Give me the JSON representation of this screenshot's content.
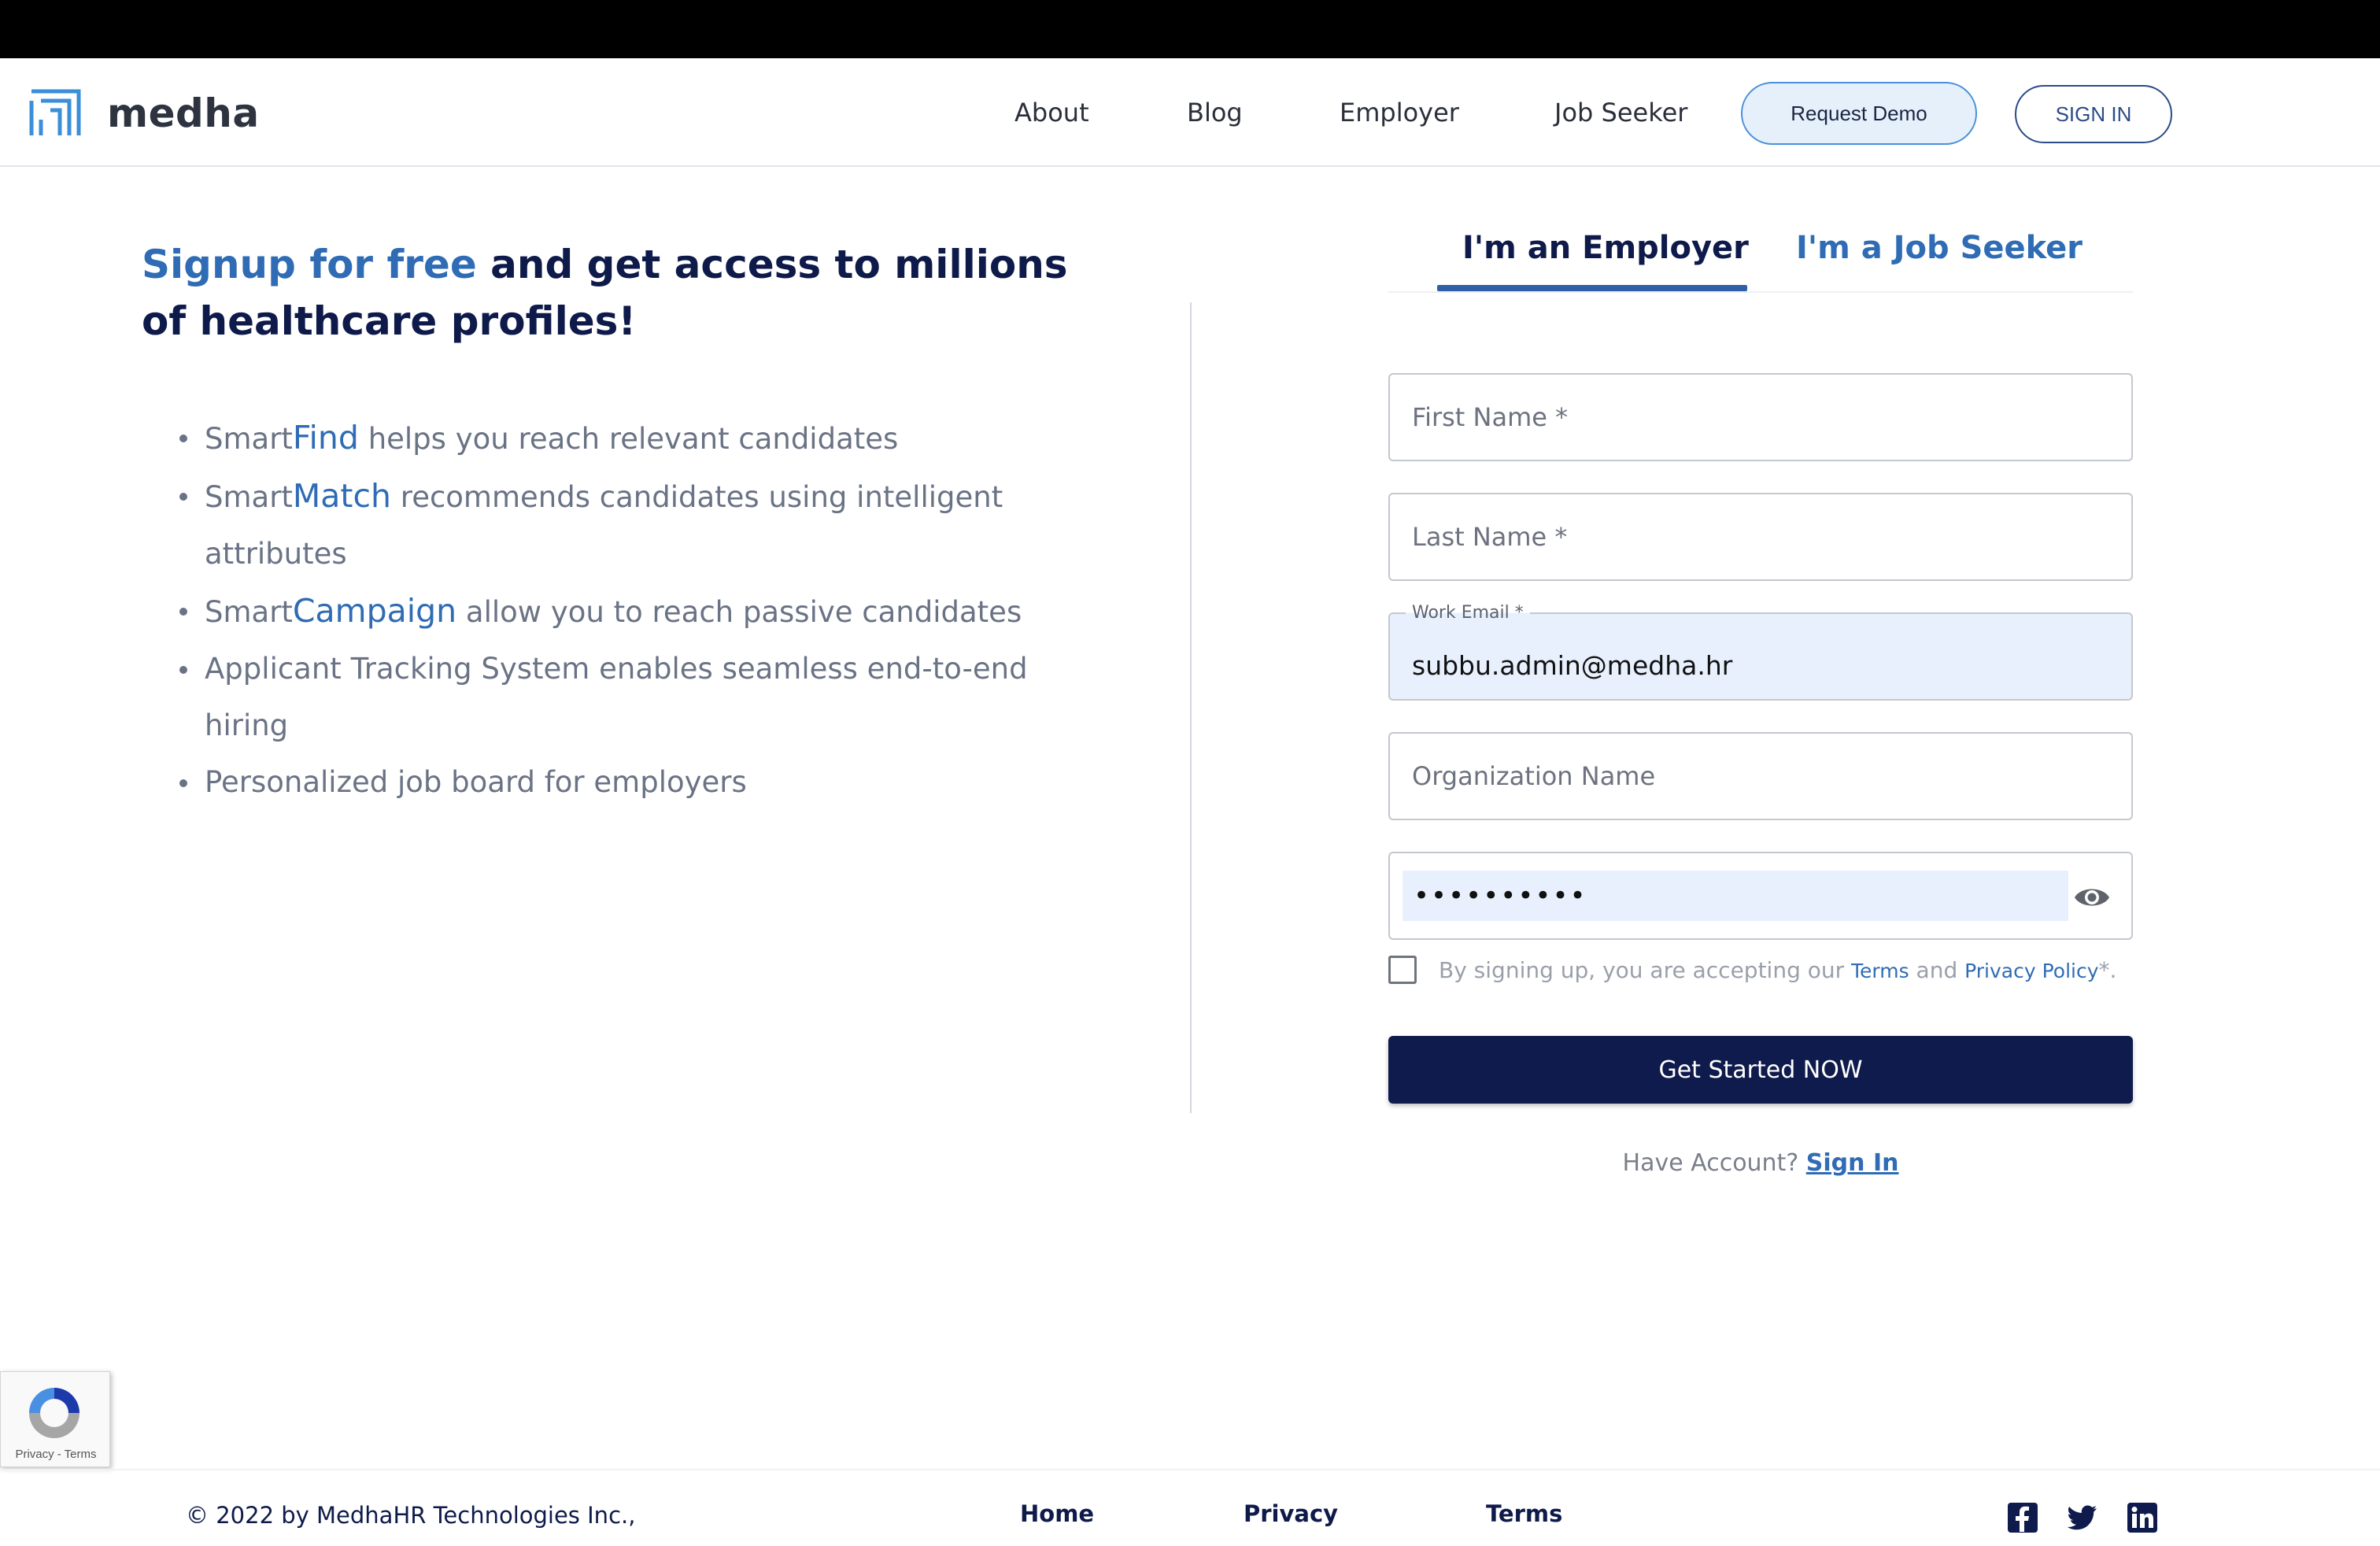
{
  "nav": {
    "logo_text": "medha",
    "links": [
      "About",
      "Blog",
      "Employer",
      "Job Seeker"
    ],
    "request_demo": "Request Demo",
    "sign_in": "SIGN IN"
  },
  "hero": {
    "headline_accent": "Signup for free",
    "headline_rest": " and get access to millions of healthcare profiles!",
    "features": [
      {
        "prefix": "Smart",
        "highlight": "Find",
        "text": " helps you reach relevant candidates"
      },
      {
        "prefix": "Smart",
        "highlight": "Match",
        "text": " recommends candidates using intelligent attributes"
      },
      {
        "prefix": "Smart",
        "highlight": "Campaign",
        "text": " allow you to reach passive candidates"
      },
      {
        "prefix": "",
        "highlight": "",
        "text": "Applicant Tracking System enables seamless end-to-end hiring"
      },
      {
        "prefix": "",
        "highlight": "",
        "text": "Personalized job board for employers"
      }
    ]
  },
  "form": {
    "tabs": [
      "I'm an Employer",
      "I'm a Job Seeker"
    ],
    "first_name_placeholder": "First Name *",
    "last_name_placeholder": "Last Name *",
    "email_label": "Work Email *",
    "email_value": "subbu.admin@medha.hr",
    "org_placeholder": "Organization Name",
    "password_value": "••••••••••",
    "terms_prefix": "By signing up, you are accepting our ",
    "terms_link": "Terms",
    "terms_and": " and ",
    "privacy_link": "Privacy Policy",
    "terms_suffix": "*.",
    "cta": "Get Started NOW",
    "have_account": "Have Account? ",
    "sign_in_link": "Sign In"
  },
  "recaptcha": {
    "text": "Privacy - Terms"
  },
  "footer": {
    "copyright": "© 2022 by MedhaHR Technologies Inc.,",
    "links": [
      "Home",
      "Privacy",
      "Terms"
    ]
  },
  "icons": [
    "medha-logo-icon",
    "eye-icon",
    "recaptcha-icon",
    "facebook-icon",
    "twitter-icon",
    "linkedin-icon"
  ],
  "colors": {
    "accent": "#2f6cb5",
    "navy": "#0f1b4c",
    "autofill": "#e8f0fe"
  }
}
